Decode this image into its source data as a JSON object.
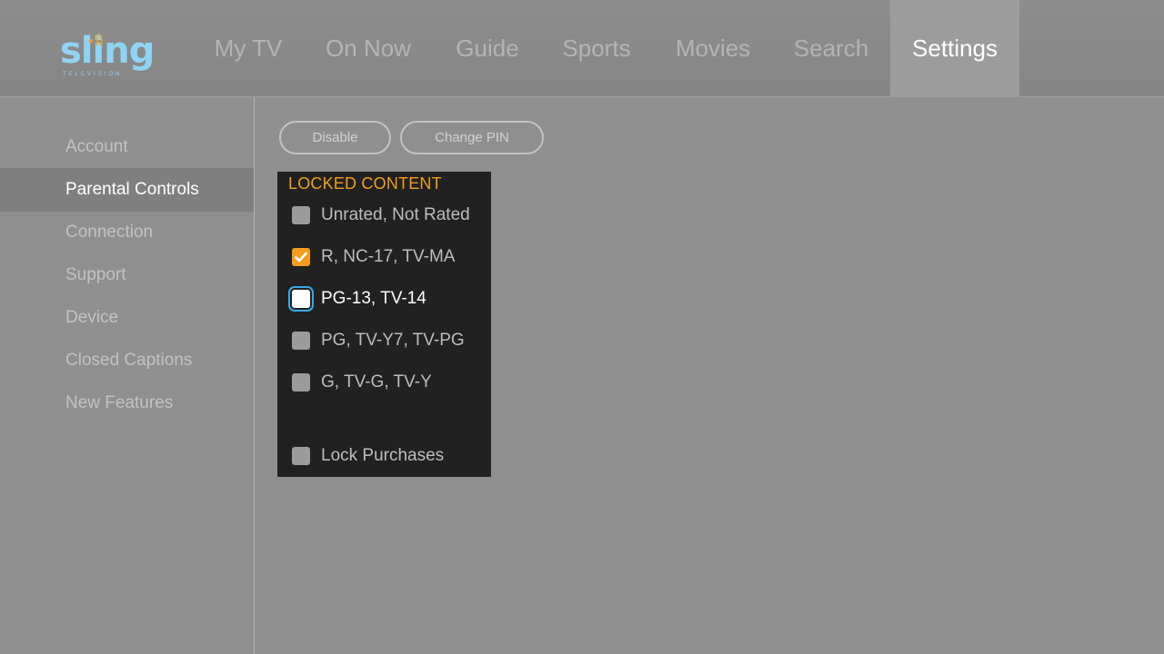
{
  "brand": {
    "name": "sling",
    "subtitle": "TELEVISION",
    "color": "#8fd3f5"
  },
  "nav": {
    "items": [
      {
        "label": "My TV"
      },
      {
        "label": "On Now"
      },
      {
        "label": "Guide"
      },
      {
        "label": "Sports"
      },
      {
        "label": "Movies"
      },
      {
        "label": "Search"
      },
      {
        "label": "Settings"
      }
    ],
    "active": "Settings"
  },
  "sidebar": {
    "items": [
      {
        "label": "Account"
      },
      {
        "label": "Parental Controls"
      },
      {
        "label": "Connection"
      },
      {
        "label": "Support"
      },
      {
        "label": "Device"
      },
      {
        "label": "Closed Captions"
      },
      {
        "label": "New Features"
      }
    ],
    "active": "Parental Controls"
  },
  "actions": {
    "disable_label": "Disable",
    "change_pin_label": "Change PIN"
  },
  "locked_content": {
    "title": "LOCKED CONTENT",
    "accent_color": "#f39c1d",
    "focus_color": "#35a9e8",
    "ratings": [
      {
        "label": "Unrated, Not Rated",
        "checked": false,
        "focused": false
      },
      {
        "label": "R, NC-17, TV-MA",
        "checked": true,
        "focused": false
      },
      {
        "label": "PG-13, TV-14",
        "checked": false,
        "focused": true
      },
      {
        "label": "PG, TV-Y7, TV-PG",
        "checked": false,
        "focused": false
      },
      {
        "label": "G, TV-G, TV-Y",
        "checked": false,
        "focused": false
      }
    ],
    "lock_purchases": {
      "label": "Lock Purchases",
      "checked": false
    }
  }
}
